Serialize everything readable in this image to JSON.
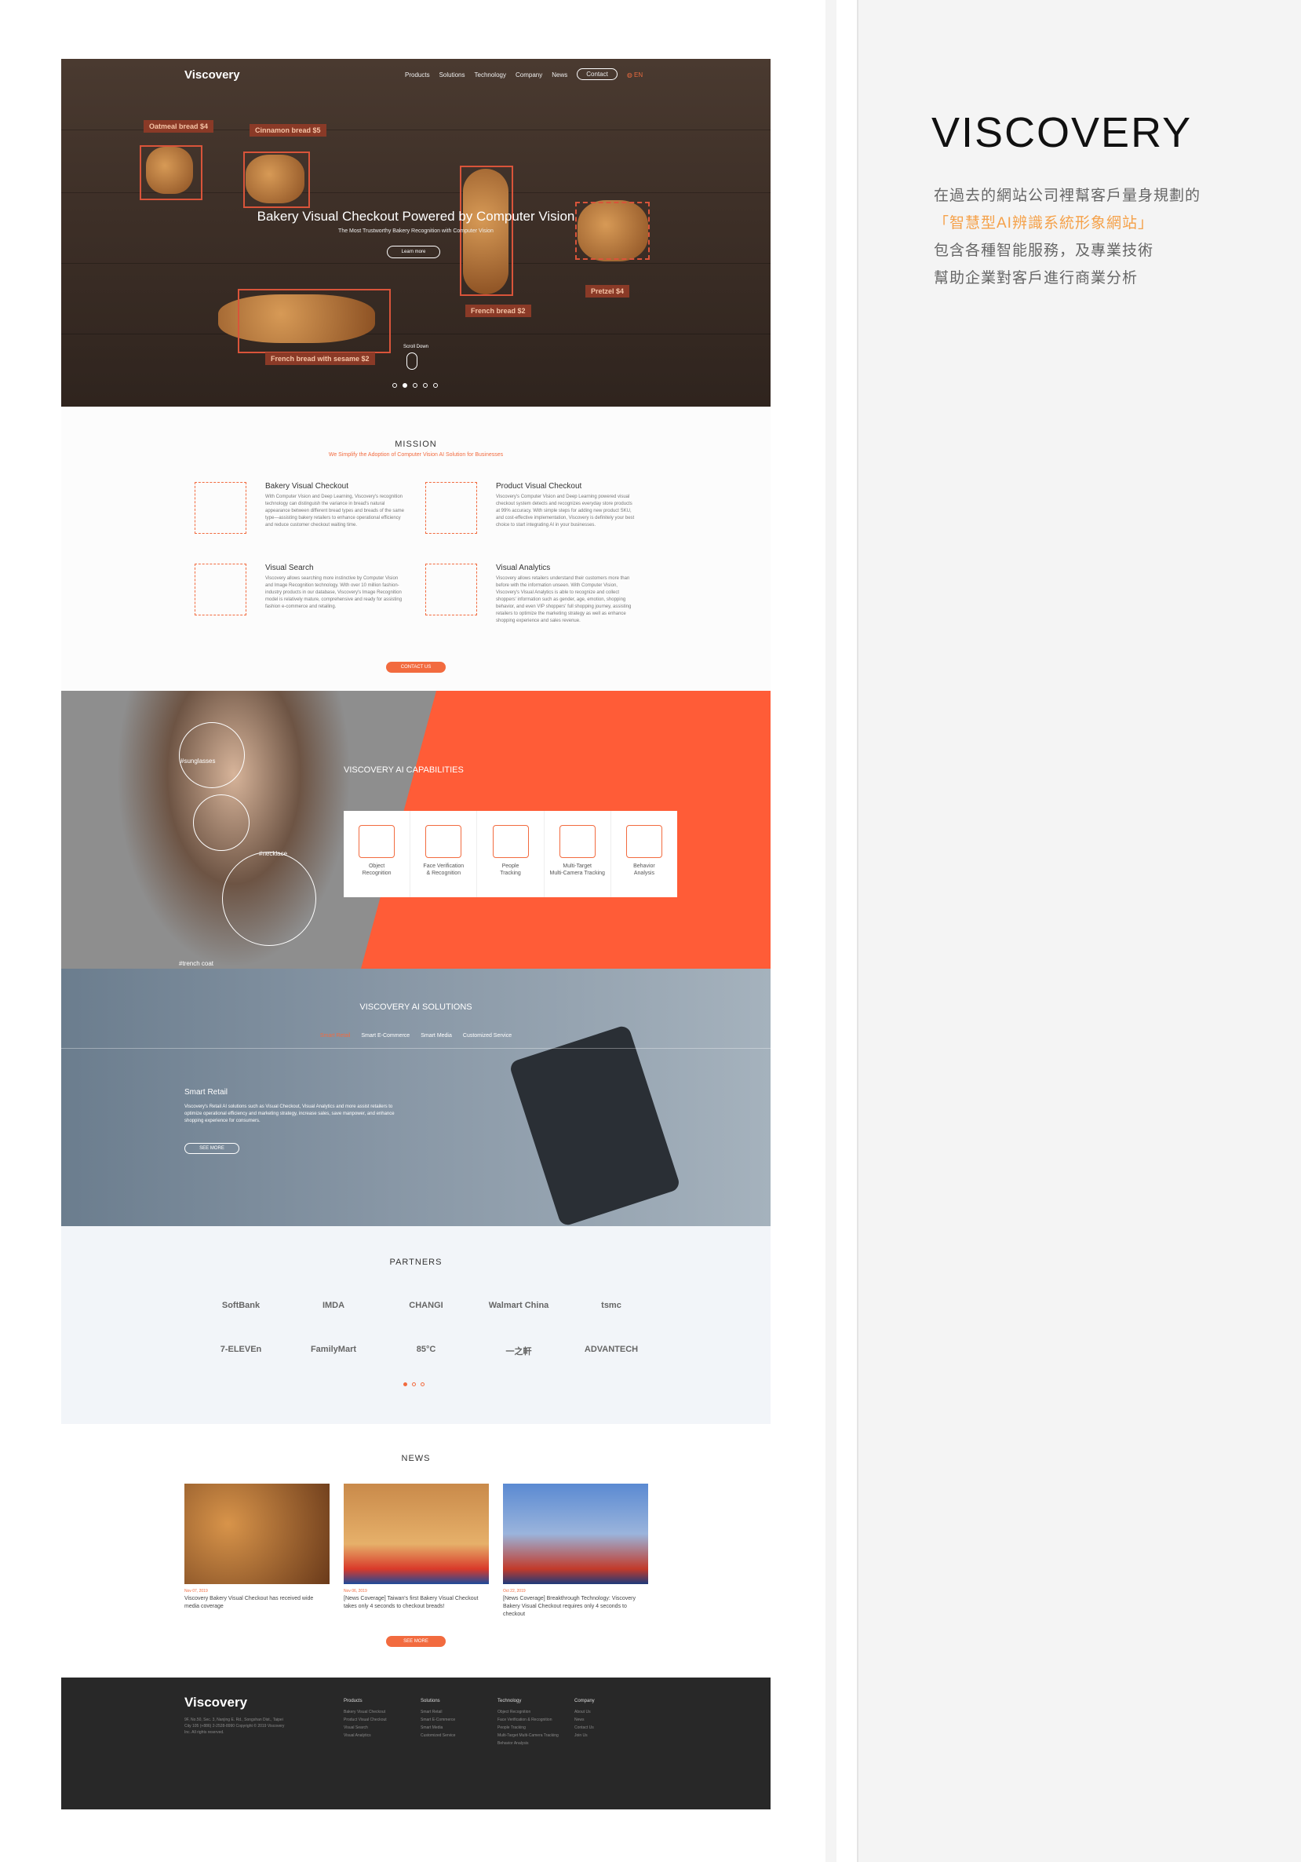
{
  "side": {
    "title": "VISCOVERY",
    "lines": [
      "在過去的網站公司裡幫客戶量身規劃的",
      "「智慧型AI辨識系統形象網站」",
      "包含各種智能服務，及專業技術",
      "幫助企業對客戶進行商業分析"
    ]
  },
  "hero": {
    "logo": "Viscovery",
    "nav": [
      "Products",
      "Solutions",
      "Technology",
      "Company",
      "News"
    ],
    "contact": "Contact",
    "lang": "EN",
    "tags": [
      "Oatmeal bread $4",
      "Cinnamon bread $5",
      "French bread $2",
      "Pretzel $4",
      "French bread with sesame $2"
    ],
    "title": "Bakery Visual Checkout Powered by Computer Vision",
    "subtitle": "The Most Trustworthy Bakery Recognition with Computer Vision",
    "learn": "Learn more",
    "scroll": "Scroll Down"
  },
  "mission": {
    "title": "MISSION",
    "subtitle": "We Simplify the Adoption of Computer Vision AI Solution for Businesses",
    "features": [
      {
        "title": "Bakery Visual Checkout",
        "desc": "With Computer Vision and Deep Learning, Viscovery's recognition technology can distinguish the variance in bread's natural appearance between different bread types and breads of the same type—assisting bakery retailers to enhance operational efficiency and reduce customer checkout waiting time."
      },
      {
        "title": "Product Visual Checkout",
        "desc": "Viscovery's Computer Vision and Deep Learning powered visual checkout system detects and recognizes everyday store products at 99% accuracy. With simple steps for adding new product SKU, and cost-effective implementation, Viscovery is definitely your best choice to start integrating AI in your businesses."
      },
      {
        "title": "Visual Search",
        "desc": "Viscovery allows searching more instinctive by Computer Vision and Image Recognition technology. With over 10 million fashion-industry products in our database, Viscovery's Image Recognition model is relatively mature, comprehensive and ready for assisting fashion e-commerce and retailing."
      },
      {
        "title": "Visual Analytics",
        "desc": "Viscovery allows retailers understand their customers more than before with the information unseen. With Computer Vision, Viscovery's Visual Analytics is able to recognize and collect shoppers' information such as gender, age, emotion, shopping behavior, and even VIP shoppers' full shopping journey, assisting retailers to optimize the marketing strategy as well as enhance shopping experience and sales revenue."
      }
    ],
    "button": "CONTACT US"
  },
  "capabilities": {
    "title": "VISCOVERY AI CAPABILITIES",
    "tags": [
      "#sunglasses",
      "#necklace",
      "#trench coat"
    ],
    "items": [
      [
        "Object",
        "Recognition"
      ],
      [
        "Face Verification",
        "& Recognition"
      ],
      [
        "People",
        "Tracking"
      ],
      [
        "Multi-Target",
        "Multi-Camera Tracking"
      ],
      [
        "Behavior",
        "Analysis"
      ]
    ]
  },
  "solutions": {
    "title": "VISCOVERY AI SOLUTIONS",
    "tabs": [
      "Smart Retail",
      "Smart E-Commerce",
      "Smart Media",
      "Customized Service"
    ],
    "heading": "Smart Retail",
    "desc": "Viscovery's Retail AI solutions such as Visual Checkout, Visual Analytics and more assist retailers to optimize operational efficiency and marketing strategy, increase sales, save manpower, and enhance shopping experience for consumers.",
    "button": "SEE MORE"
  },
  "partners": {
    "title": "PARTNERS",
    "row1": [
      "SoftBank",
      "IMDA",
      "CHANGI",
      "Walmart China",
      "tsmc"
    ],
    "row2": [
      "7-ELEVEn",
      "FamilyMart",
      "85°C",
      "一之軒",
      "ADVANTECH"
    ]
  },
  "news": {
    "title": "NEWS",
    "items": [
      {
        "date": "Nov 07, 2019",
        "text": "Viscovery Bakery Visual Checkout has received wide media coverage"
      },
      {
        "date": "Nov 06, 2019",
        "text": "[News Coverage] Taiwan's first Bakery Visual Checkout takes only 4 seconds to checkout breads!"
      },
      {
        "date": "Oct 22, 2019",
        "text": "[News Coverage] Breakthrough Technology: Viscovery Bakery Visual Checkout requires only 4 seconds to checkout"
      }
    ],
    "button": "SEE MORE"
  },
  "footer": {
    "logo": "Viscovery",
    "address": "9F, No.50, Sec. 3, Nanjing E. Rd., Songshan Dist., Taipei City 105 (+886) 2-2528-8990 Copyright © 2019 Viscovery Inc. All rights reserved.",
    "columns": [
      {
        "h": "Products",
        "items": [
          "Bakery Visual Checkout",
          "Product Visual Checkout",
          "Visual Search",
          "Visual Analytics"
        ]
      },
      {
        "h": "Solutions",
        "items": [
          "Smart Retail",
          "Smart E-Commerce",
          "Smart Media",
          "Customized Service"
        ]
      },
      {
        "h": "Technology",
        "items": [
          "Object Recognition",
          "Face Verification & Recognition",
          "People Tracking",
          "Multi-Target Multi-Camera Tracking",
          "Behavior Analysis"
        ]
      },
      {
        "h": "Company",
        "items": [
          "About Us",
          "News",
          "Contact Us",
          "Join Us"
        ]
      }
    ]
  },
  "colors": {
    "accent": "#f26b3f",
    "dark": "#282828",
    "side_highlight": "#f5a149"
  }
}
